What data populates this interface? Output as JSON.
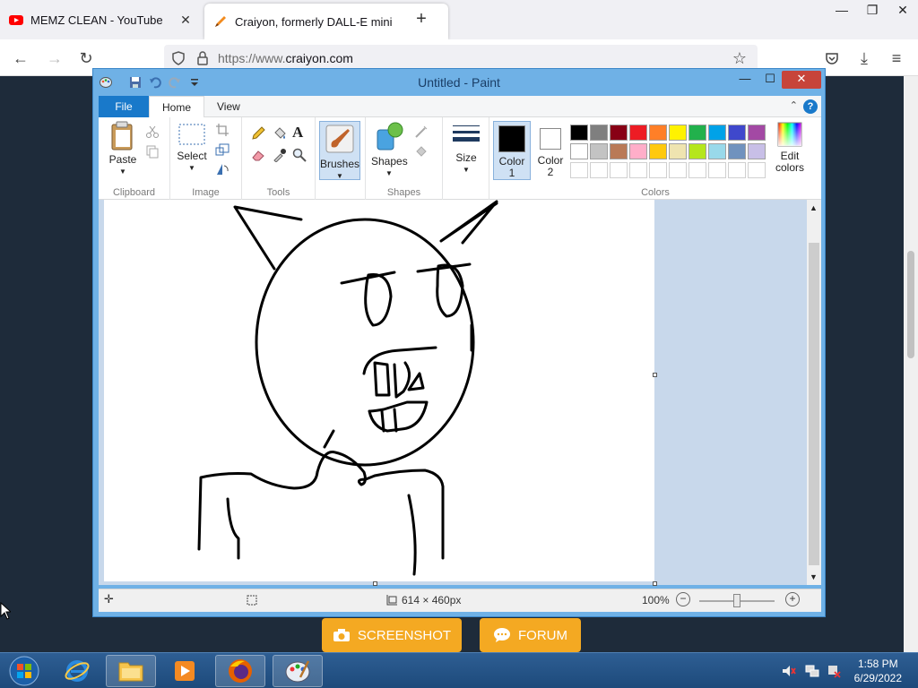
{
  "browser": {
    "tabs": [
      {
        "title": "MEMZ CLEAN - YouTube",
        "active": false
      },
      {
        "title": "Craiyon, formerly DALL-E mini",
        "active": true
      }
    ],
    "url_prefix": "https://www.",
    "url_host": "craiyon.com",
    "new_tab": "+"
  },
  "page": {
    "screenshot_label": "SCREENSHOT",
    "forum_label": "FORUM"
  },
  "paint": {
    "title": "Untitled - Paint",
    "tabs": {
      "file": "File",
      "home": "Home",
      "view": "View"
    },
    "ribbon": {
      "paste": "Paste",
      "clipboard": "Clipboard",
      "select": "Select",
      "image": "Image",
      "tools": "Tools",
      "brushes": "Brushes",
      "shapes": "Shapes",
      "shapes_group": "Shapes",
      "size": "Size",
      "color1": "Color",
      "color1_num": "1",
      "color2": "Color",
      "color2_num": "2",
      "edit_colors_1": "Edit",
      "edit_colors_2": "colors",
      "colors_group": "Colors"
    },
    "palette": [
      "#000000",
      "#7f7f7f",
      "#880015",
      "#ed1c24",
      "#ff7f27",
      "#fff200",
      "#22b14c",
      "#00a2e8",
      "#3f48cc",
      "#a349a4",
      "#ffffff",
      "#c3c3c3",
      "#b97a57",
      "#ffaec9",
      "#ffc90e",
      "#efe4b0",
      "#b5e61d",
      "#99d9ea",
      "#7092be",
      "#c8bfe7",
      "#ffffff",
      "#ffffff",
      "#ffffff",
      "#ffffff",
      "#ffffff",
      "#ffffff",
      "#ffffff",
      "#ffffff",
      "#ffffff",
      "#ffffff"
    ],
    "color1_value": "#000000",
    "color2_value": "#ffffff",
    "status": {
      "image_size": "614 × 460px",
      "zoom": "100%"
    }
  },
  "taskbar": {
    "time": "1:58 PM",
    "date": "6/29/2022"
  }
}
